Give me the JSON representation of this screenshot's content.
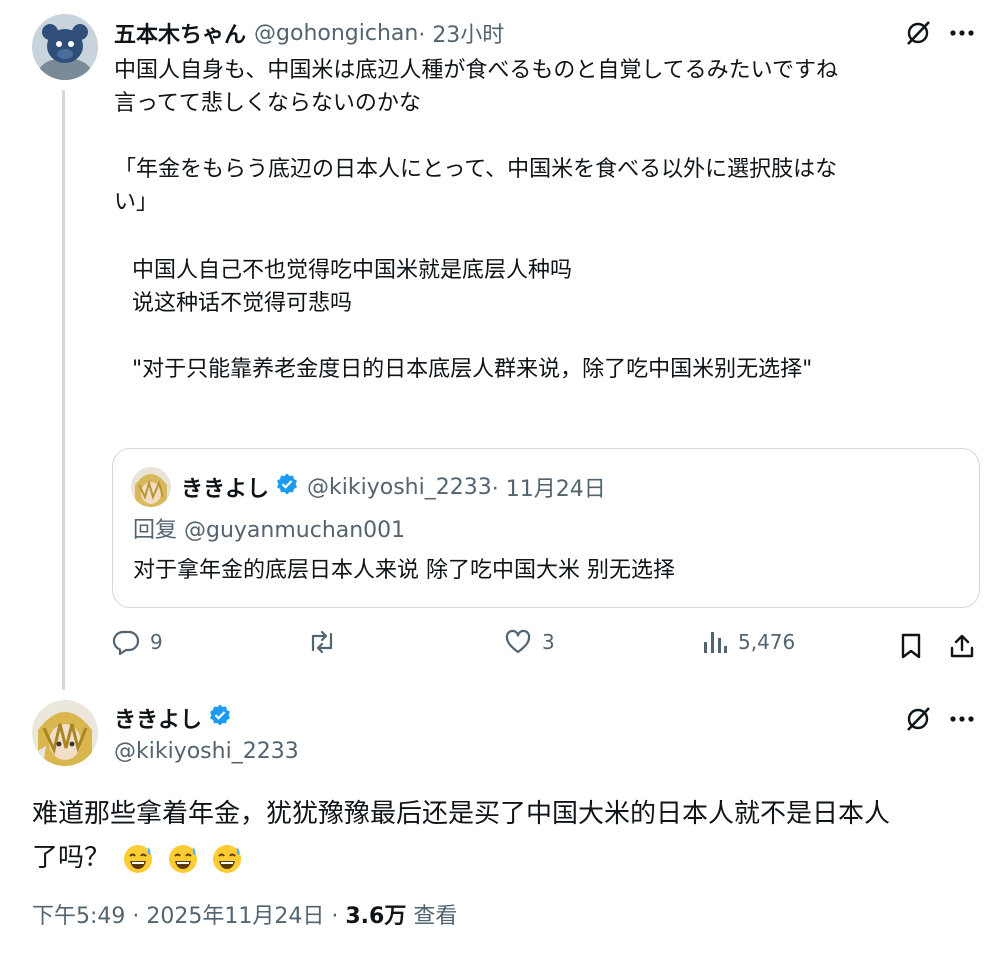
{
  "post1": {
    "author_name": "五本木ちゃん",
    "author_handle": "@gohongichan",
    "time": " · 23小时",
    "text": "中国人自身も、中国米は底辺人種が食べるものと自覚してるみたいですね\n言ってて悲しくならないのかな\n\n「年金をもらう底辺の日本人にとって、中国米を食べる以外に選択肢はな\nい」",
    "translation": "中国人自己不也觉得吃中国米就是底层人种吗\n说这种话不觉得可悲吗\n\n\"对于只能靠养老金度日的日本底层人群来说，除了吃中国米别无选择\"",
    "quote": {
      "author_name": "ききよし",
      "author_handle": "@kikiyoshi_2233",
      "time": " · 11月24日",
      "reply_to": "回复 @guyanmuchan001",
      "text": "对于拿年金的底层日本人来说 除了吃中国大米 别无选择"
    },
    "actions": {
      "replies": "9",
      "reposts": "",
      "likes": "3",
      "views": "5,476"
    }
  },
  "post2": {
    "author_name": "ききよし",
    "author_handle": "@kikiyoshi_2233",
    "text_line1": "难道那些拿着年金，犹犹豫豫最后还是买了中国大米的日本人就不是日本人",
    "text_line2": "了吗？",
    "emojis": [
      "sweat-smile-emoji",
      "sweat-smile-emoji",
      "sweat-smile-emoji"
    ],
    "time": "下午5:49 · 2025年11月24日 · ",
    "views": "3.6万",
    "views_label": " 查看"
  },
  "colors": {
    "verified": "#1d9bf0",
    "muted": "#536471",
    "border": "#cfd9de"
  }
}
